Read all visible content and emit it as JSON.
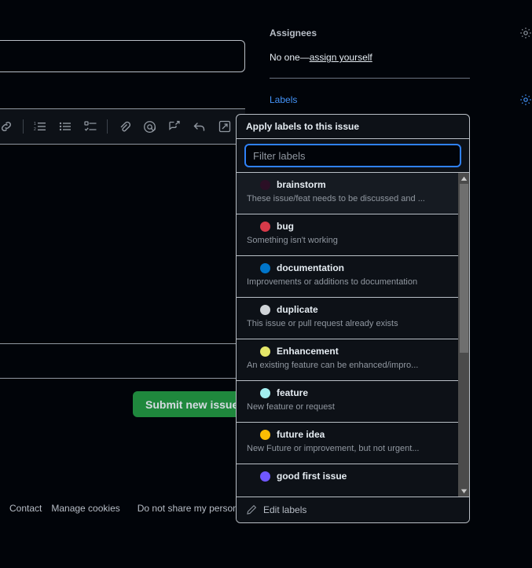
{
  "colors": {
    "page_bg": "#010409",
    "popup_bg": "#0d1117",
    "accent_blue": "#4493f8",
    "focus_blue": "#2f81f7",
    "submit_green": "#1f883d",
    "border": "#b9bfc6",
    "muted_text": "#9198a1"
  },
  "form": {
    "title_placeholder": "",
    "title_value": "",
    "submit_label": "Submit new issue",
    "toolbar": [
      {
        "name": "link-icon",
        "label": "Add a link"
      },
      {
        "name": "ordered-list-icon",
        "label": "Add ordered list"
      },
      {
        "name": "unordered-list-icon",
        "label": "Add unordered list"
      },
      {
        "name": "task-list-icon",
        "label": "Add task list"
      },
      {
        "name": "attachment-icon",
        "label": "Attach files"
      },
      {
        "name": "mention-icon",
        "label": "Mention a user"
      },
      {
        "name": "saved-reply-icon",
        "label": "Saved replies"
      },
      {
        "name": "reply-arrow-icon",
        "label": "Reference in new issue"
      }
    ]
  },
  "footer": {
    "links": [
      "Contact",
      "Manage cookies",
      "Do not share my personal"
    ]
  },
  "sidebar": {
    "assignees": {
      "title": "Assignees",
      "gear": "gear-icon",
      "value_prefix": "No one—",
      "value_link": "assign yourself"
    },
    "labels": {
      "title": "Labels",
      "gear": "gear-icon"
    }
  },
  "labels_popup": {
    "header": "Apply labels to this issue",
    "filter_placeholder": "Filter labels",
    "filter_value": "",
    "edit_labels": "Edit labels",
    "edit_icon": "pencil-icon",
    "scroll_up_icon": "triangle-up-icon",
    "scroll_down_icon": "triangle-down-icon",
    "items": [
      {
        "name": "brainstorm",
        "desc": "These issue/feat needs to be discussed and ...",
        "color": "#2b0f25",
        "hovered": true
      },
      {
        "name": "bug",
        "desc": "Something isn't working",
        "color": "#d73a49",
        "hovered": false
      },
      {
        "name": "documentation",
        "desc": "Improvements or additions to documentation",
        "color": "#0075ca",
        "hovered": false
      },
      {
        "name": "duplicate",
        "desc": "This issue or pull request already exists",
        "color": "#cfd3d7",
        "hovered": false
      },
      {
        "name": "Enhancement",
        "desc": "An existing feature can be enhanced/impro...",
        "color": "#e4e669",
        "hovered": false
      },
      {
        "name": "feature",
        "desc": "New feature or request",
        "color": "#a2eeef",
        "hovered": false
      },
      {
        "name": "future idea",
        "desc": "New Future or improvement, but not urgent...",
        "color": "#fbbc04",
        "hovered": false
      },
      {
        "name": "good first issue",
        "desc": "",
        "color": "#7057ff",
        "hovered": false
      }
    ]
  }
}
